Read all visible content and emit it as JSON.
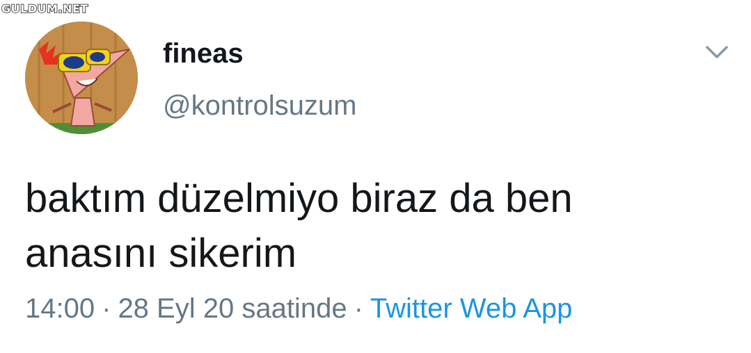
{
  "watermark": "GULDUM.NET",
  "tweet": {
    "display_name": "fineas",
    "handle": "@kontrolsuzum",
    "text_lines": [
      "baktım düzelmiyo biraz da ben",
      "anasını sikerim"
    ],
    "time": "14:00",
    "separator": "·",
    "date_label": "28 Eyl 20 saatinde",
    "source": "Twitter Web App"
  },
  "icons": {
    "menu": "chevron-down-icon",
    "avatar": "avatar-image"
  },
  "colors": {
    "text": "#14171a",
    "secondary": "#657786",
    "link": "#1b95e0",
    "background": "#ffffff"
  }
}
